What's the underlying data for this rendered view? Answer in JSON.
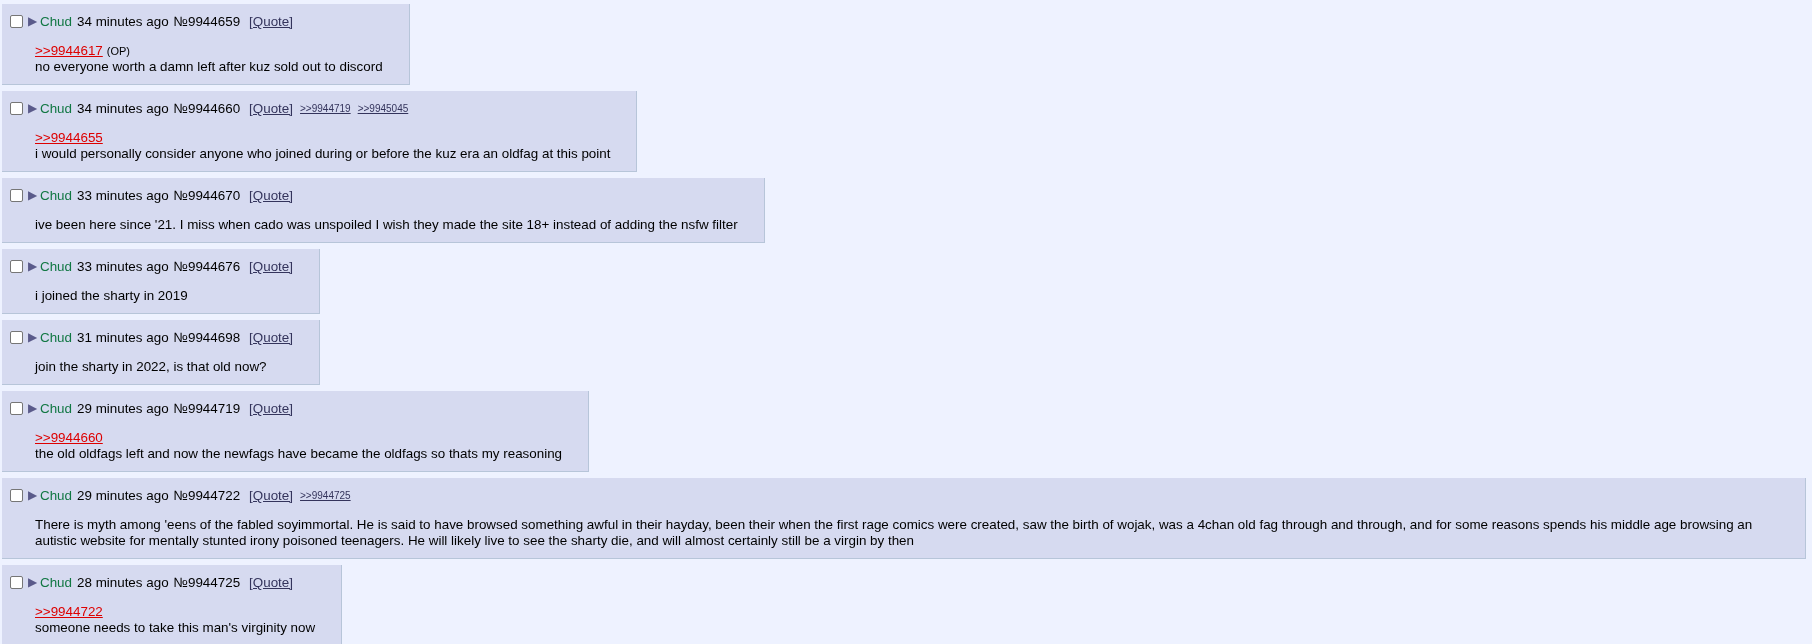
{
  "posts": [
    {
      "checked": false,
      "arrow": "▶",
      "name": "Chud",
      "time": "34 minutes ago",
      "number": "№9944659",
      "quote_link": "[Quote]",
      "reply_to": ">>9944617",
      "reply_note": "(OP)",
      "text": "no everyone worth a damn left after kuz sold out to discord"
    },
    {
      "checked": false,
      "arrow": "▶",
      "name": "Chud",
      "time": "34 minutes ago",
      "number": "№9944660",
      "quote_link": "[Quote]",
      "backlinks": [
        ">>9944719",
        ">>9945045"
      ],
      "reply_to": ">>9944655",
      "text": "i would personally consider anyone who joined during or before the kuz era an oldfag at this point"
    },
    {
      "checked": false,
      "arrow": "▶",
      "name": "Chud",
      "time": "33 minutes ago",
      "number": "№9944670",
      "quote_link": "[Quote]",
      "text": "ive been here since '21. I miss when cado was unspoiled I wish they made the site 18+ instead of adding the nsfw filter"
    },
    {
      "checked": false,
      "arrow": "▶",
      "name": "Chud",
      "time": "33 minutes ago",
      "number": "№9944676",
      "quote_link": "[Quote]",
      "text": "i joined the sharty in 2019"
    },
    {
      "checked": false,
      "arrow": "▶",
      "name": "Chud",
      "time": "31 minutes ago",
      "number": "№9944698",
      "quote_link": "[Quote]",
      "text": "join the sharty in 2022, is that old now?"
    },
    {
      "checked": false,
      "arrow": "▶",
      "name": "Chud",
      "time": "29 minutes ago",
      "number": "№9944719",
      "quote_link": "[Quote]",
      "reply_to": ">>9944660",
      "text": "the old oldfags left and now the newfags have became the oldfags so thats my reasoning"
    },
    {
      "checked": false,
      "arrow": "▶",
      "name": "Chud",
      "time": "29 minutes ago",
      "number": "№9944722",
      "quote_link": "[Quote]",
      "backlinks": [
        ">>9944725"
      ],
      "text": "There is myth among 'eens of the fabled soyimmortal. He is said to have browsed something awful in their hayday, been their when the first rage comics were created, saw the birth of wojak, was a 4chan old fag through and through, and for some reasons spends his middle age browsing an autistic website for mentally stunted irony poisoned teenagers. He will likely live to see the sharty die, and will almost certainly still be a virgin by then"
    },
    {
      "checked": false,
      "arrow": "▶",
      "name": "Chud",
      "time": "28 minutes ago",
      "number": "№9944725",
      "quote_link": "[Quote]",
      "reply_to": ">>9944722",
      "text": "someone needs to take this man's virginity now"
    }
  ]
}
